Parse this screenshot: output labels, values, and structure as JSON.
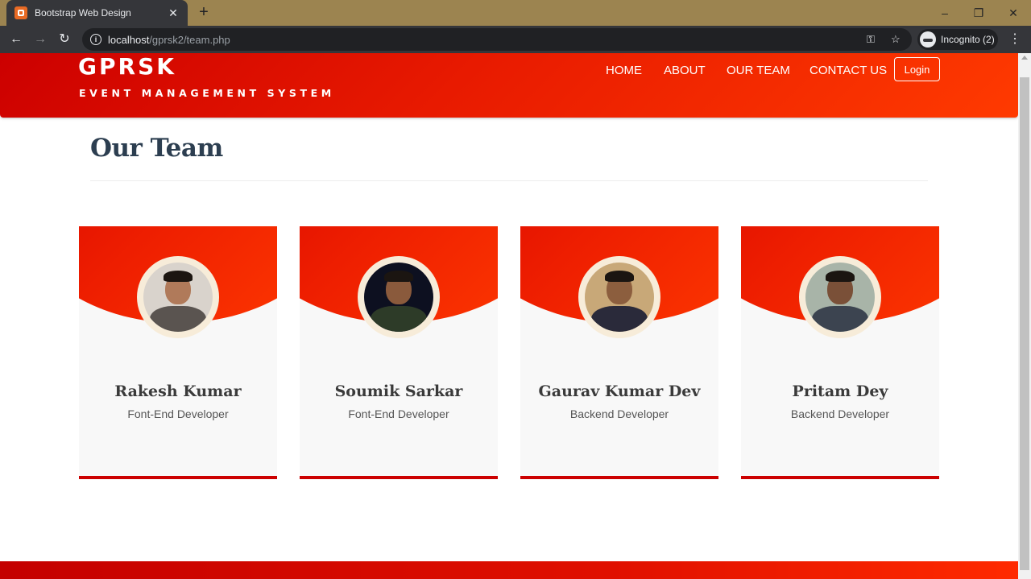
{
  "browser": {
    "tab_title": "Bootstrap Web Design",
    "tab_close": "✕",
    "new_tab": "+",
    "url_host": "localhost",
    "url_path": "/gprsk2/team.php",
    "incognito_label": "Incognito (2)"
  },
  "header": {
    "brand": "GPRSK",
    "brand_sub": "EVENT MANAGEMENT SYSTEM",
    "nav": [
      "HOME",
      "ABOUT",
      "OUR TEAM",
      "CONTACT US"
    ],
    "login_label": "Login",
    "gradient_colors": [
      "#cc0000",
      "#ff3a00"
    ]
  },
  "page": {
    "title": "Our Team"
  },
  "team": [
    {
      "name": "Rakesh Kumar",
      "role": "Font-End Developer",
      "photo_bg": "#d9d3cc",
      "skin": "#b07a5a",
      "shirt": "#5a5450"
    },
    {
      "name": "Soumik Sarkar",
      "role": "Font-End Developer",
      "photo_bg": "#0d1020",
      "skin": "#8a5a3c",
      "shirt": "#2d3b28"
    },
    {
      "name": "Gaurav Kumar Dev",
      "role": "Backend Developer",
      "photo_bg": "#c8a878",
      "skin": "#8c5e3e",
      "shirt": "#2a2a3a"
    },
    {
      "name": "Pritam Dey",
      "role": "Backend Developer",
      "photo_bg": "#a8b4a8",
      "skin": "#7a5038",
      "shirt": "#3c4450"
    }
  ],
  "colors": {
    "accent": "#cc0000",
    "title_text": "#2c3e50",
    "card_bg": "#f8f8f8"
  }
}
